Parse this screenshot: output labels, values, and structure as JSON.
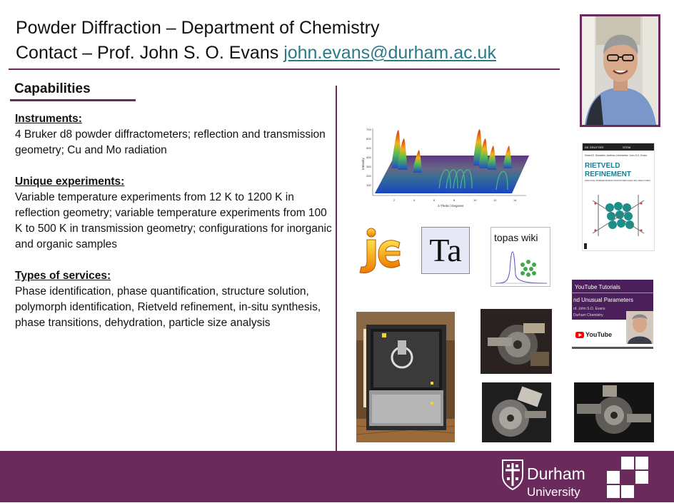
{
  "header": {
    "line1": "Powder Diffraction – Department of Chemistry",
    "line2_prefix": "Contact – Prof. John S. O. Evans ",
    "email": "john.evans@durham.ac.uk"
  },
  "capabilities": {
    "heading": "Capabilities",
    "sections": [
      {
        "title": "Instruments:",
        "body": "4 Bruker d8 powder diffractometers; reflection and transmission geometry; Cu and Mo radiation"
      },
      {
        "title": "Unique experiments:",
        "body": "Variable temperature experiments from 12 K to 1200 K in reflection geometry; variable temperature experiments from 100 K to 500 K in transmission geometry; configurations for inorganic and organic samples"
      },
      {
        "title": "Types of services:",
        "body": "Phase identification, phase quantification, structure solution, polymorph identification, Rietveld refinement, in-situ synthesis, phase transitions, dehydration, particle size analysis"
      }
    ]
  },
  "images": {
    "plot_ylabel": "Intensity",
    "plot_xlabel": "2-Theta / Degrees",
    "plot_yticks": [
      "700",
      "600",
      "500",
      "400",
      "300",
      "200",
      "100"
    ],
    "plot_xticks": [
      "2",
      "4",
      "6",
      "8",
      "10",
      "12",
      "14"
    ],
    "ta_logo": "Ta",
    "topas_label": "topas wiki",
    "book_publisher": "DE GRUYTER",
    "book_series": "STEM",
    "book_authors": "Robert E. Dinnebier, Andreas Leineweber, John S.O. Evans",
    "book_title_1": "RIETVELD",
    "book_title_2": "REFINEMENT",
    "book_subtitle": "PRACTICAL POWDER DIFFRACTION PATTERN ANALYSIS USING TOPAS",
    "yt_title": "YouTube Tutorials",
    "yt_sub": "nd Unusual Parameters",
    "yt_author": "of. John S.O. Evans",
    "yt_dept": "Durham Chemistry",
    "yt_logo": "YouTube"
  },
  "footer": {
    "name": "Durham",
    "university": "University"
  },
  "colors": {
    "brand_purple": "#6b2a5c",
    "link_teal": "#2a7a8a"
  }
}
